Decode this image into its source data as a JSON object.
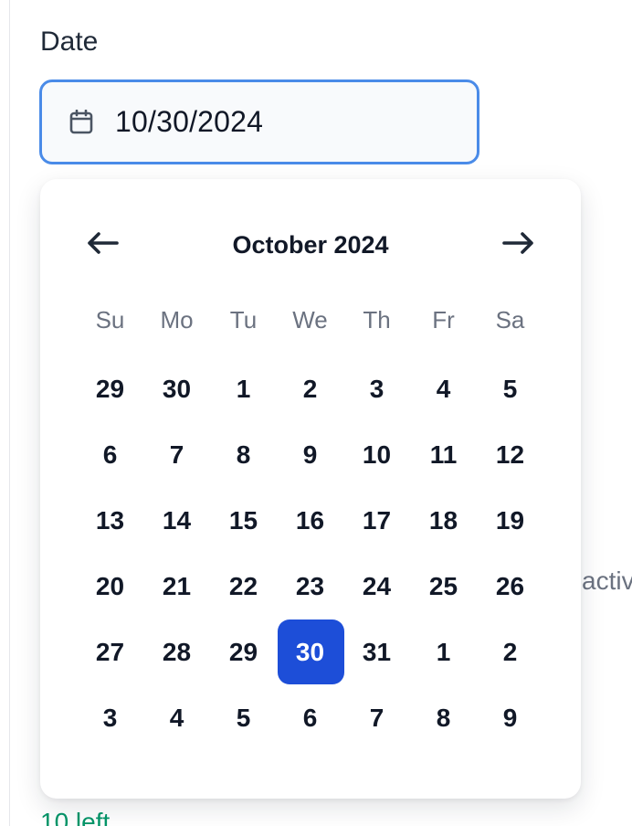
{
  "field": {
    "label": "Date",
    "value": "10/30/2024"
  },
  "calendar": {
    "month_title": "October 2024",
    "weekdays": [
      "Su",
      "Mo",
      "Tu",
      "We",
      "Th",
      "Fr",
      "Sa"
    ],
    "weeks": [
      [
        "29",
        "30",
        "1",
        "2",
        "3",
        "4",
        "5"
      ],
      [
        "6",
        "7",
        "8",
        "9",
        "10",
        "11",
        "12"
      ],
      [
        "13",
        "14",
        "15",
        "16",
        "17",
        "18",
        "19"
      ],
      [
        "20",
        "21",
        "22",
        "23",
        "24",
        "25",
        "26"
      ],
      [
        "27",
        "28",
        "29",
        "30",
        "31",
        "1",
        "2"
      ],
      [
        "3",
        "4",
        "5",
        "6",
        "7",
        "8",
        "9"
      ]
    ],
    "selected_day": "30",
    "prev_icon": "arrow-left-icon",
    "next_icon": "arrow-right-icon"
  },
  "background": {
    "partial_text": "activ",
    "left_text": "10 left"
  },
  "colors": {
    "focus_ring": "#4a8be8",
    "selected_bg": "#1d4ed8",
    "muted_text": "#6b7280",
    "success_text": "#059669"
  }
}
